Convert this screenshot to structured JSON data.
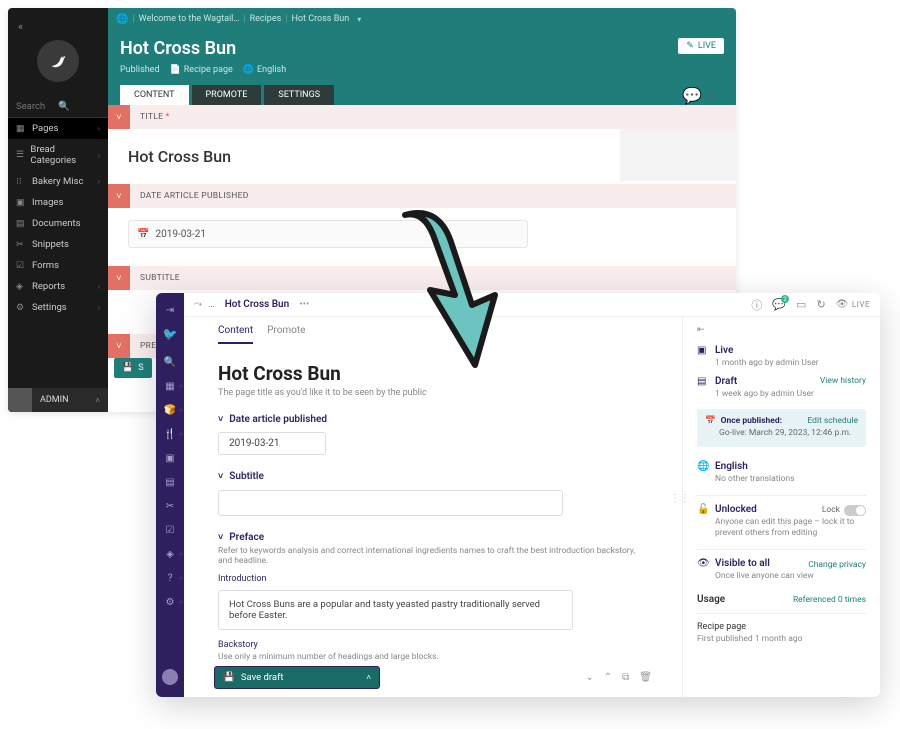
{
  "old": {
    "breadcrumb": {
      "home": "🌐",
      "root": "Welcome to the Wagtail…",
      "recipes": "Recipes",
      "current": "Hot Cross Bun"
    },
    "title": "Hot Cross Bun",
    "live_btn": "LIVE",
    "meta": {
      "status": "Published",
      "type": "Recipe page",
      "lang": "English"
    },
    "tabs": {
      "content": "CONTENT",
      "promote": "PROMOTE",
      "settings": "SETTINGS"
    },
    "search_placeholder": "Search",
    "nav": {
      "pages": "Pages",
      "bread": "Bread Categories",
      "bakery": "Bakery Misc",
      "images": "Images",
      "documents": "Documents",
      "snippets": "Snippets",
      "forms": "Forms",
      "reports": "Reports",
      "settings": "Settings"
    },
    "admin": "ADMIN",
    "sections": {
      "title": {
        "label": "TITLE",
        "value": "Hot Cross Bun"
      },
      "date": {
        "label": "DATE ARTICLE PUBLISHED",
        "value": "2019-03-21"
      },
      "subtitle": {
        "label": "SUBTITLE"
      },
      "preface": {
        "label": "PREFA"
      }
    },
    "save_btn": "S"
  },
  "new": {
    "breadcrumb": "Hot Cross Bun",
    "live": "LIVE",
    "tabs": {
      "content": "Content",
      "promote": "Promote"
    },
    "title": "Hot Cross Bun",
    "title_hint": "The page title as you'd like it to be seen by the public",
    "fields": {
      "date": {
        "label": "Date article published",
        "value": "2019-03-21"
      },
      "subtitle": {
        "label": "Subtitle"
      },
      "preface": {
        "label": "Preface",
        "hint": "Refer to keywords analysis and correct international ingredients names to craft the best introduction backstory, and headline."
      },
      "intro": {
        "label": "Introduction",
        "value": "Hot Cross Buns are a popular and tasty yeasted pastry traditionally served before Easter."
      },
      "backstory": {
        "label": "Backstory",
        "hint": "Use only a minimum number of headings and large blocks."
      }
    },
    "save_draft": "Save draft",
    "right": {
      "live": {
        "title": "Live",
        "sub": "1 month ago by admin User"
      },
      "draft": {
        "title": "Draft",
        "sub": "1 week ago by admin User",
        "link": "View history"
      },
      "schedule": {
        "label": "Once published:",
        "golive_label": "Go-live:",
        "golive_value": "March 29, 2023, 12:46 p.m.",
        "link": "Edit schedule"
      },
      "lang": {
        "title": "English",
        "sub": "No other translations"
      },
      "lock": {
        "title": "Unlocked",
        "sub": "Anyone can edit this page – lock it to prevent others from editing",
        "label": "Lock"
      },
      "privacy": {
        "title": "Visible to all",
        "sub": "Once live anyone can view",
        "link": "Change privacy"
      },
      "usage": {
        "title": "Usage",
        "link": "Referenced 0 times"
      },
      "footer": {
        "type": "Recipe page",
        "pub": "First published 1 month ago"
      }
    }
  }
}
